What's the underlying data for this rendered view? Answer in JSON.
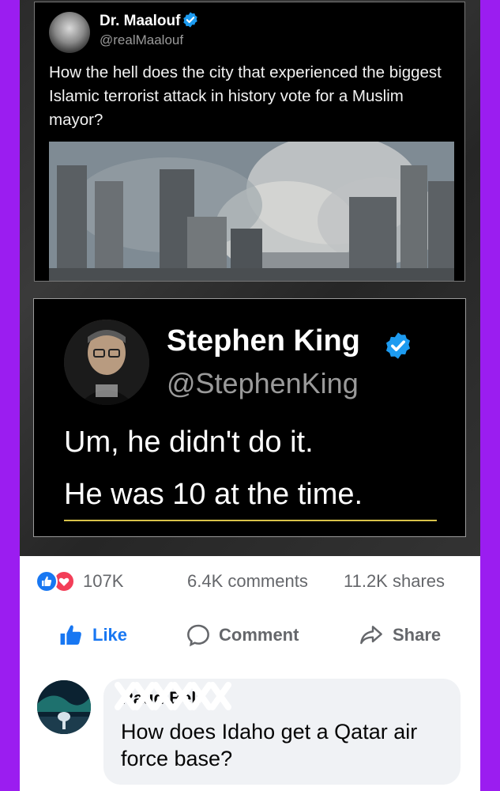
{
  "tweet1": {
    "name": "Dr. Maalouf",
    "handle": "@realMaalouf",
    "text": "How the hell does the city that experienced the biggest Islamic terrorist attack in history vote for a Muslim mayor?"
  },
  "tweet2": {
    "name": "Stephen King",
    "handle": "@StephenKing",
    "line1": "Um, he didn't do it.",
    "line2": "He was 10 at the time."
  },
  "reactions": {
    "count": "107K",
    "comments": "6.4K comments",
    "shares": "11.2K shares"
  },
  "actions": {
    "like": "Like",
    "comment": "Comment",
    "share": "Share"
  },
  "comment": {
    "author": "Raud Bell",
    "text": "How does Idaho get a Qatar air force base?"
  },
  "colors": {
    "background": "#9b1df0",
    "fb_blue": "#1877f2",
    "love_red": "#f33e58",
    "verified_blue": "#1d9bf0",
    "muted_gray": "#65676b"
  },
  "icons": [
    "verified-badge-icon",
    "like-reaction-icon",
    "love-reaction-icon",
    "thumbs-up-icon",
    "comment-bubble-icon",
    "share-arrow-icon"
  ]
}
